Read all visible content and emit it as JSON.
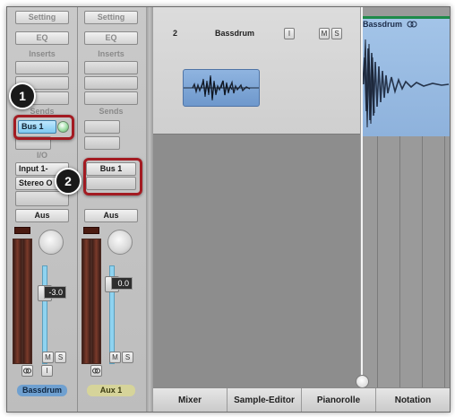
{
  "strip_1": {
    "setting": "Setting",
    "eq": "EQ",
    "inserts_label": "Inserts",
    "sends_label": "Sends",
    "send_slot": "Bus 1",
    "io_label": "I/O",
    "input": "Input 1-",
    "output": "Stereo O",
    "automation": "Aus",
    "fader_value": "-3.0",
    "mute": "M",
    "solo": "S",
    "link_icon": "link-icon",
    "input_monitor": "I",
    "name": "Bassdrum",
    "name_color": "#6fa0d0"
  },
  "strip_2": {
    "setting": "Setting",
    "eq": "EQ",
    "inserts_label": "Inserts",
    "sends_label": "Sends",
    "input": "Bus 1",
    "automation": "Aus",
    "fader_value": "0.0",
    "mute": "M",
    "solo": "S",
    "link_icon": "link-icon",
    "name": "Aux 1",
    "name_color": "#d6d49a"
  },
  "callouts": {
    "first": "1",
    "second": "2",
    "highlight_color": "#a31b22"
  },
  "track": {
    "number": "2",
    "name": "Bassdrum",
    "input_button": "I",
    "mute": "M",
    "solo": "S"
  },
  "region": {
    "name": "Bassdrum",
    "color": "#a3c4e8"
  },
  "tabs": [
    "Mixer",
    "Sample-Editor",
    "Pianorolle",
    "Notation"
  ]
}
